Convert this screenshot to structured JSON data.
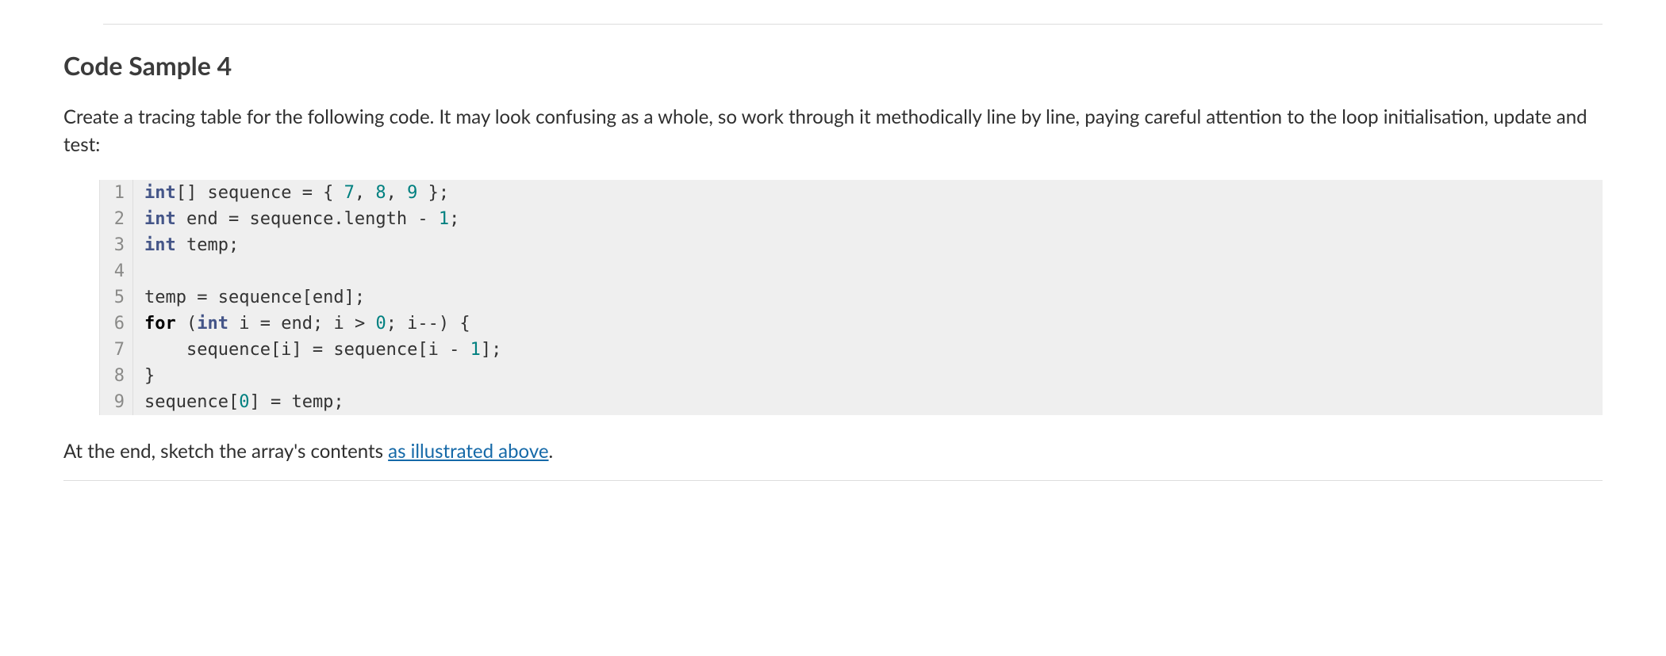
{
  "heading": "Code Sample 4",
  "intro": "Create a tracing table for the following code. It may look confusing as a whole, so work through it methodically line by line, paying careful attention to the loop initialisation, update and test:",
  "code": {
    "lines": [
      {
        "n": "1",
        "tokens": [
          {
            "t": "int",
            "c": "kw-type"
          },
          {
            "t": "[] sequence = { ",
            "c": "punct"
          },
          {
            "t": "7",
            "c": "num"
          },
          {
            "t": ", ",
            "c": "punct"
          },
          {
            "t": "8",
            "c": "num"
          },
          {
            "t": ", ",
            "c": "punct"
          },
          {
            "t": "9",
            "c": "num"
          },
          {
            "t": " };",
            "c": "punct"
          }
        ]
      },
      {
        "n": "2",
        "tokens": [
          {
            "t": "int",
            "c": "kw-type"
          },
          {
            "t": " end = sequence.length - ",
            "c": "punct"
          },
          {
            "t": "1",
            "c": "num"
          },
          {
            "t": ";",
            "c": "punct"
          }
        ]
      },
      {
        "n": "3",
        "tokens": [
          {
            "t": "int",
            "c": "kw-type"
          },
          {
            "t": " temp;",
            "c": "punct"
          }
        ]
      },
      {
        "n": "4",
        "tokens": [
          {
            "t": "",
            "c": "punct"
          }
        ]
      },
      {
        "n": "5",
        "tokens": [
          {
            "t": "temp = sequence[end];",
            "c": "punct"
          }
        ]
      },
      {
        "n": "6",
        "tokens": [
          {
            "t": "for",
            "c": "kw-for"
          },
          {
            "t": " (",
            "c": "punct"
          },
          {
            "t": "int",
            "c": "kw-type"
          },
          {
            "t": " i = end; i > ",
            "c": "punct"
          },
          {
            "t": "0",
            "c": "num"
          },
          {
            "t": "; i--) {",
            "c": "punct"
          }
        ]
      },
      {
        "n": "7",
        "tokens": [
          {
            "t": "    sequence[i] = sequence[i - ",
            "c": "punct"
          },
          {
            "t": "1",
            "c": "num"
          },
          {
            "t": "];",
            "c": "punct"
          }
        ]
      },
      {
        "n": "8",
        "tokens": [
          {
            "t": "}",
            "c": "punct"
          }
        ]
      },
      {
        "n": "9",
        "tokens": [
          {
            "t": "sequence[",
            "c": "punct"
          },
          {
            "t": "0",
            "c": "num"
          },
          {
            "t": "] = temp;",
            "c": "punct"
          }
        ]
      }
    ]
  },
  "outro_prefix": "At the end, sketch the array's contents ",
  "outro_link": "as illustrated above",
  "outro_suffix": "."
}
